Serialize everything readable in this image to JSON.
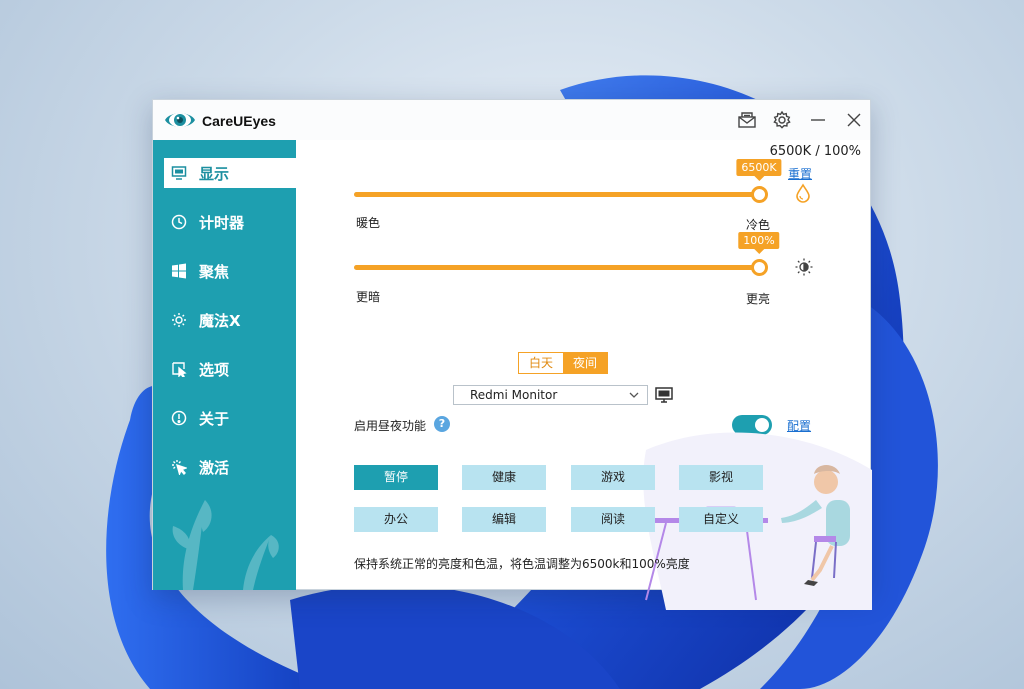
{
  "window": {
    "title": "CareUEyes",
    "buttons": [
      "mail-icon",
      "gear-icon",
      "minimize-icon",
      "close-icon"
    ]
  },
  "sidebar": {
    "items": [
      {
        "label": "显示",
        "icon": "monitor-icon",
        "active": true
      },
      {
        "label": "计时器",
        "icon": "clock-icon",
        "active": false
      },
      {
        "label": "聚焦",
        "icon": "windows-icon",
        "active": false
      },
      {
        "label": "魔法X",
        "icon": "sun-icon",
        "active": false
      },
      {
        "label": "选项",
        "icon": "pointer-icon",
        "active": false
      },
      {
        "label": "关于",
        "icon": "info-icon",
        "active": false
      },
      {
        "label": "激活",
        "icon": "sparkle-cursor-icon",
        "active": false
      }
    ]
  },
  "display": {
    "readout": "6500K / 100%",
    "reset": "重置",
    "color_temp": {
      "tooltip": "6500K",
      "fraction": 1.0,
      "left_label": "暖色",
      "right_label": "冷色"
    },
    "brightness": {
      "tooltip": "100%",
      "fraction": 1.0,
      "left_label": "更暗",
      "right_label": "更亮"
    },
    "mode": {
      "day": "白天",
      "night": "夜间",
      "selected": "夜间"
    },
    "monitor": "Redmi Monitor",
    "daynight_label": "启用昼夜功能",
    "help": "?",
    "daynight_enabled": true,
    "config": "配置",
    "presets": [
      "暂停",
      "健康",
      "游戏",
      "影视",
      "办公",
      "编辑",
      "阅读",
      "自定义"
    ],
    "active_preset": "暂停",
    "description": "保持系统正常的亮度和色温，将色温调整为6500k和100%亮度"
  },
  "colors": {
    "accent": "#1e9fb0",
    "orange": "#f5a226",
    "preset_bg": "#b8e3f0",
    "link": "#1a6fd0"
  }
}
